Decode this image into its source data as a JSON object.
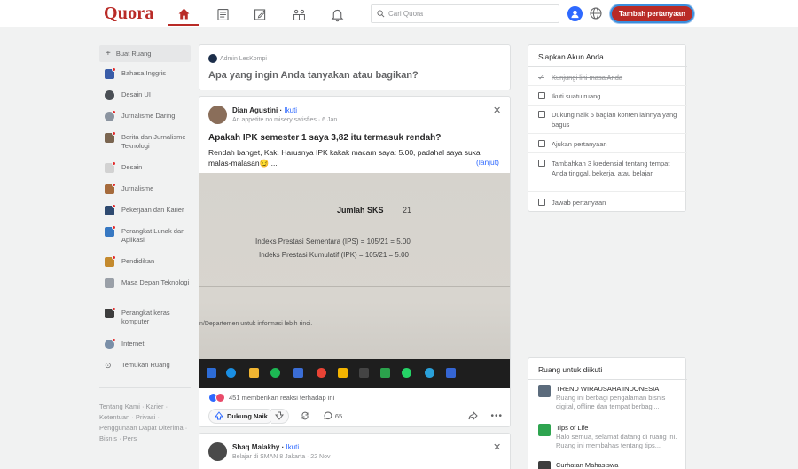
{
  "header": {
    "logo": "Quora",
    "search_placeholder": "Cari Quora",
    "add_question_label": "Tambah pertanyaan",
    "nav_icons": [
      "home-icon",
      "feed-icon",
      "write-icon",
      "spaces-icon",
      "bell-icon"
    ],
    "brand_color": "#b92b27"
  },
  "sidebar": {
    "create_space": "Buat Ruang",
    "items": [
      {
        "label": "Bahasa Inggris",
        "icon_color": "#3a5da8"
      },
      {
        "label": "Desain UI",
        "icon_color": "#4a4f55"
      },
      {
        "label": "Jurnalisme Daring",
        "icon_color": "#8b94a0"
      },
      {
        "label": "Berita dan Jurnalisme Teknologi",
        "icon_color": "#7a6550"
      },
      {
        "label": "Desain",
        "icon_color": "#d2d2d2"
      },
      {
        "label": "Jurnalisme",
        "icon_color": "#a66b3c"
      },
      {
        "label": "Pekerjaan dan Karier",
        "icon_color": "#2f4a70"
      },
      {
        "label": "Perangkat Lunak dan Aplikasi",
        "icon_color": "#3778c2"
      },
      {
        "label": "Pendidikan",
        "icon_color": "#c48a2e"
      },
      {
        "label": "Masa Depan Teknologi",
        "icon_color": "#9aa0a8"
      },
      {
        "label": "Perangkat keras komputer",
        "icon_color": "#3d3d3d"
      },
      {
        "label": "Internet",
        "icon_color": "#7a8fa8"
      }
    ],
    "discover": "Temukan Ruang",
    "footer": "Tentang Kami · Karier · Ketentuan · Privasi · Penggunaan Dapat Diterima · Bisnis · Pers"
  },
  "ask": {
    "user": "Admin LesKompi",
    "prompt": "Apa yang ingin Anda tanyakan atau bagikan?"
  },
  "post": {
    "author": "Dian Agustini",
    "follow": "Ikuti",
    "credential": "An appetite no misery satisfies · 6 Jan",
    "title": "Apakah IPK semester 1 saya 3,82 itu termasuk rendah?",
    "body": "Rendah banget, Kak. Harusnya IPK kakak macam saya: 5.00, padahal saya suka malas-malasan😏 ...",
    "more": "(lanjut)",
    "image_text": {
      "sks_label": "Jumlah SKS",
      "sks_value": "21",
      "ips": "Indeks Prestasi Sementara (IPS) = 105/21 = 5.00",
      "ipk": "Indeks Prestasi Kumulatif (IPK) = 105/21 = 5.00",
      "footer": "n/Departemen untuk informasi lebih rinci."
    },
    "reactions": "451 memberikan reaksi terhadap ini",
    "upvote_label": "Dukung Naik",
    "comments": "65"
  },
  "post2": {
    "author": "Shaq Malakhy",
    "follow": "Ikuti",
    "credential": "Belajar di SMAN 8 Jakarta · 22 Nov"
  },
  "setup": {
    "title": "Siapkan Akun Anda",
    "tasks": [
      {
        "label": "Kunjungi lini masa Anda",
        "done": true
      },
      {
        "label": "Ikuti suatu ruang",
        "done": false
      },
      {
        "label": "Dukung naik 5 bagian konten lainnya yang bagus",
        "done": false
      },
      {
        "label": "Ajukan pertanyaan",
        "done": false
      },
      {
        "label": "Tambahkan 3 kredensial tentang tempat Anda tinggal, bekerja, atau belajar",
        "done": false
      },
      {
        "label": "Jawab pertanyaan",
        "done": false
      }
    ]
  },
  "spaces": {
    "title": "Ruang untuk diikuti",
    "items": [
      {
        "name": "TREND WIRAUSAHA INDONESIA",
        "desc": "Ruang ini berbagi pengalaman bisnis digital, offline dan tempat berbagi...",
        "icon_color": "#5b6b7c"
      },
      {
        "name": "Tips of Life",
        "desc": "Halo semua, selamat datang di ruang ini. Ruang ini membahas tentang tips...",
        "icon_color": "#2ea44f"
      },
      {
        "name": "Curhatan Mahasiswa",
        "desc": "",
        "icon_color": "#3d3d3d"
      }
    ]
  }
}
